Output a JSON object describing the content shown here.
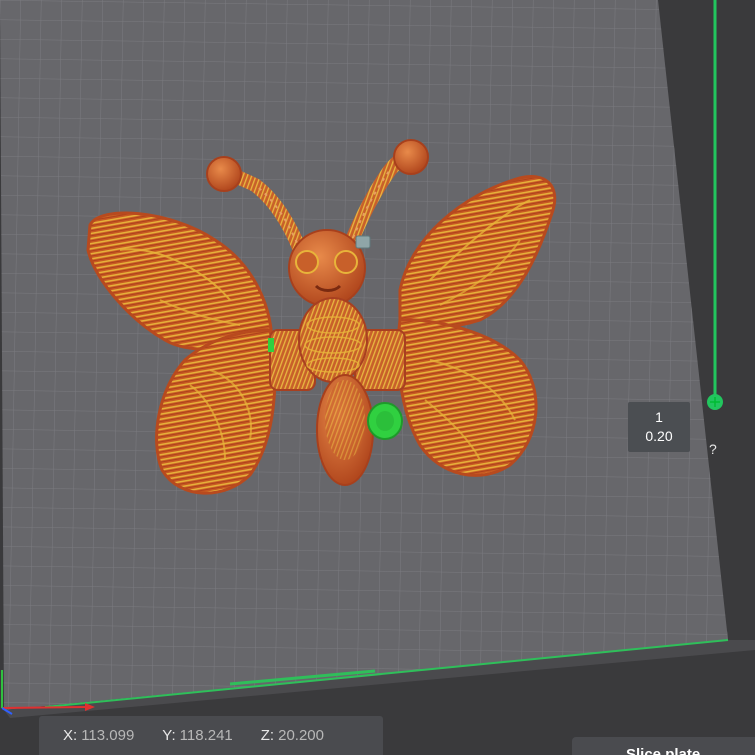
{
  "layer_slider": {
    "layer_number": "1",
    "layer_height": "0.20",
    "help_label": "?",
    "track_color": "#22c55e"
  },
  "coordinates": {
    "x_label": "X:",
    "x_value": "113.099",
    "y_label": "Y:",
    "y_value": "118.241",
    "z_label": "Z:",
    "z_value": "20.200"
  },
  "slice_button": {
    "label": "Slice plate"
  },
  "colors": {
    "background": "#3a3a3c",
    "plate": "#67676b",
    "grid_line": "#7a7a7e",
    "model_orange": "#d4692a",
    "model_stripe": "#e8b43a",
    "model_dark": "#9a3b1e",
    "support_green": "#30d040"
  },
  "icons": {
    "axis_gizmo": "axes-icon",
    "slider_handle": "plus-handle-icon"
  }
}
